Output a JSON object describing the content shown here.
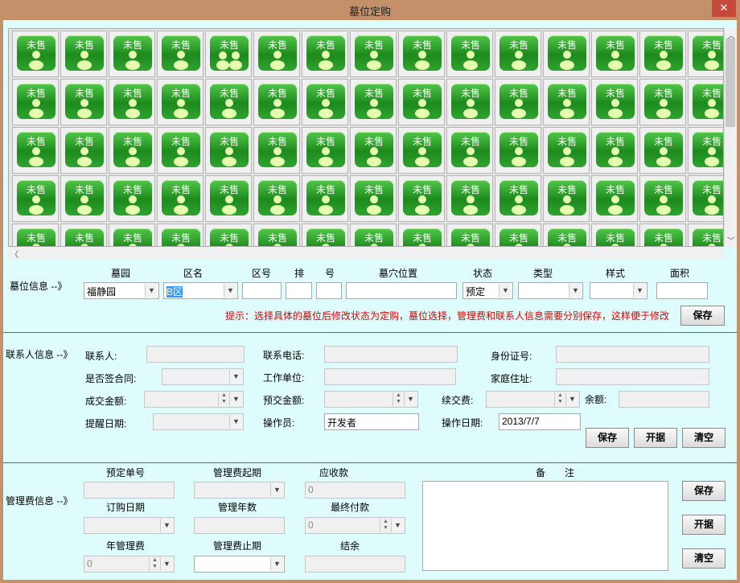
{
  "window": {
    "title": "墓位定购",
    "close_glyph": "✕"
  },
  "grid": {
    "tile_label": "未售",
    "rows": 5,
    "cols": 15,
    "double_icon_cell": 4,
    "icon": "person-icon"
  },
  "tomb": {
    "section_label": "墓位信息 --》",
    "headers": {
      "yuan": "墓园",
      "qu": "区名",
      "quhao": "区号",
      "pai": "排",
      "hao": "号",
      "pos": "墓穴位置",
      "status": "状态",
      "type": "类型",
      "style": "样式",
      "area": "面积"
    },
    "yuan_value": "福静园",
    "qu_value": "B区",
    "status_value": "预定",
    "hint": "提示：选择具体的墓位后修改状态为定购，墓位选择，管理费和联系人信息需要分别保存，这样便于修改",
    "save": "保存"
  },
  "contact": {
    "section_label": "联系人信息 --》",
    "labels": {
      "name": "联系人:",
      "phone": "联系电话:",
      "id": "身份证号:",
      "contract": "是否签合同:",
      "work": "工作单位:",
      "home": "家庭住址:",
      "deal": "成交金额:",
      "prepay": "预交金额:",
      "renew": "续交费:",
      "balance": "余额:",
      "remind": "提醒日期:",
      "operator": "操作员:",
      "opdate": "操作日期:"
    },
    "operator_value": "开发者",
    "opdate_value": "2013/7/7",
    "buttons": {
      "save": "保存",
      "receipt": "开据",
      "clear": "清空"
    }
  },
  "fee": {
    "section_label": "管理费信息 --》",
    "labels": {
      "order_no": "预定单号",
      "start": "管理费起期",
      "receivable": "应收款",
      "order_date": "订购日期",
      "years": "管理年数",
      "final": "最终付款",
      "annual": "年管理费",
      "end": "管理费止期",
      "balance": "结余",
      "remark": "备　　注"
    },
    "receivable_value": "0",
    "final_value": "0",
    "annual_value": "0",
    "buttons": {
      "save": "保存",
      "receipt": "开据",
      "clear": "清空"
    }
  },
  "colors": {
    "tile": "#2e9e2e",
    "bg": "#dffcfc",
    "titlebar": "#c4906a",
    "close": "#c7493c",
    "hint": "#e00000"
  }
}
